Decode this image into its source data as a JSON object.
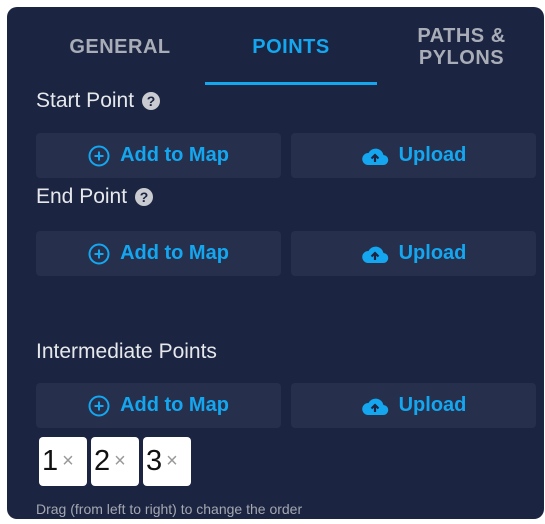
{
  "tabs": {
    "general": "GENERAL",
    "points": "POINTS",
    "paths_pylons": "PATHS &\nPYLONS",
    "active": "points"
  },
  "start_point": {
    "title": "Start Point",
    "help_icon": "question-circle-icon",
    "add_label": "Add to Map",
    "upload_label": "Upload"
  },
  "end_point": {
    "title": "End Point",
    "help_icon": "question-circle-icon",
    "add_label": "Add to Map",
    "upload_label": "Upload"
  },
  "intermediate_points": {
    "title": "Intermediate Points",
    "add_label": "Add to Map",
    "upload_label": "Upload",
    "chips": [
      {
        "label": "1",
        "remove": "×"
      },
      {
        "label": "2",
        "remove": "×"
      },
      {
        "label": "3",
        "remove": "×"
      }
    ],
    "hint": "Drag (from left to right) to change the order"
  },
  "colors": {
    "panel_bg": "#1b2440",
    "button_bg": "#262f4c",
    "accent": "#14a7f0",
    "text": "#e6e8ec",
    "muted": "#a9adb7"
  },
  "icons": {
    "add": "plus-circle-icon",
    "upload": "cloud-upload-icon"
  }
}
